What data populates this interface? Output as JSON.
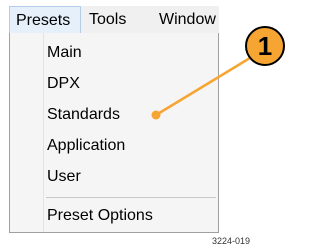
{
  "menubar": {
    "items": [
      {
        "label": "Presets"
      },
      {
        "label": "Tools"
      },
      {
        "label": "Window"
      }
    ]
  },
  "dropdown": {
    "items": [
      {
        "label": "Main"
      },
      {
        "label": "DPX"
      },
      {
        "label": "Standards"
      },
      {
        "label": "Application"
      },
      {
        "label": "User"
      }
    ],
    "footer_item": "Preset Options"
  },
  "callout": {
    "number": "1",
    "color": "#f7a532",
    "target": "Standards"
  },
  "figure_id": "3224-019"
}
